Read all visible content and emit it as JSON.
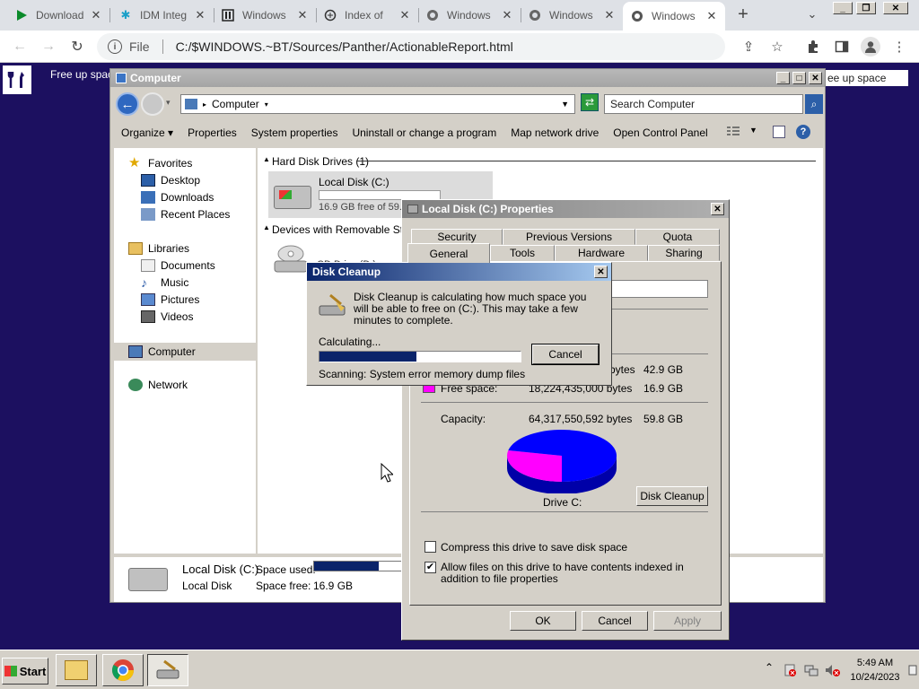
{
  "browser": {
    "tabs": [
      {
        "title": "Download",
        "icon": "play-icon"
      },
      {
        "title": "IDM Integ",
        "icon": "idm-icon"
      },
      {
        "title": "Windows",
        "icon": "archive-icon"
      },
      {
        "title": "Index of",
        "icon": "index-icon"
      },
      {
        "title": "Windows",
        "icon": "globe-icon"
      },
      {
        "title": "Windows",
        "icon": "globe-icon"
      },
      {
        "title": "Windows",
        "icon": "globe-icon"
      }
    ],
    "scheme": "File",
    "url": "C:/$WINDOWS.~BT/Sources/Panther/ActionableReport.html"
  },
  "page": {
    "left_text": "Free up spac",
    "right_text": "ee up space"
  },
  "explorer": {
    "title": "Computer",
    "breadcrumb": "Computer",
    "search_placeholder": "Search Computer",
    "commands": [
      "Organize ▾",
      "Properties",
      "System properties",
      "Uninstall or change a program",
      "Map network drive",
      "Open Control Panel"
    ],
    "nav": {
      "favorites": "Favorites",
      "desktop": "Desktop",
      "downloads": "Downloads",
      "recent": "Recent Places",
      "libraries": "Libraries",
      "documents": "Documents",
      "music": "Music",
      "pictures": "Pictures",
      "videos": "Videos",
      "computer": "Computer",
      "network": "Network"
    },
    "groups": {
      "hdd": "Hard Disk Drives (1)",
      "removable": "Devices with Removable Stora"
    },
    "drive_c": {
      "name": "Local Disk (C:)",
      "free": "16.9 GB free of 59."
    },
    "drive_d": {
      "name": "CD Drive (D:)"
    },
    "details": {
      "name": "Local Disk (C:)",
      "type": "Local Disk",
      "used_label": "Space used:",
      "free_label": "Space free:",
      "free_value": "16.9 GB",
      "used_fraction": 0.72
    }
  },
  "properties": {
    "title": "Local Disk (C:) Properties",
    "tabs_row1": [
      "Security",
      "Previous Versions",
      "Quota"
    ],
    "tabs_row2": [
      "General",
      "Tools",
      "Hardware",
      "Sharing"
    ],
    "used_bytes": "bytes",
    "used_gb": "42.9 GB",
    "free_label": "Free space:",
    "free_bytes": "18,224,435,000 bytes",
    "free_gb": "16.9 GB",
    "capacity_label": "Capacity:",
    "capacity_bytes": "64,317,550,592 bytes",
    "capacity_gb": "59.8 GB",
    "drive_label": "Drive C:",
    "cleanup_button": "Disk Cleanup",
    "compress_label": "Compress this drive to save disk space",
    "compress_checked": false,
    "index_label": "Allow files on this drive to have contents indexed in addition to file properties",
    "index_checked": true,
    "ok": "OK",
    "cancel": "Cancel",
    "apply": "Apply",
    "used_color": "#0000ff",
    "free_color": "#ff00ff",
    "used_fraction": 0.717
  },
  "disk_cleanup": {
    "title": "Disk Cleanup",
    "message": "Disk Cleanup is calculating how much space you will be able to free on  (C:). This may take a few minutes to complete.",
    "status": "Calculating...",
    "progress_fraction": 0.48,
    "cancel": "Cancel",
    "scanning": "Scanning:   System error memory dump files"
  },
  "taskbar": {
    "start": "Start",
    "time": "5:49 AM",
    "date": "10/24/2023"
  }
}
